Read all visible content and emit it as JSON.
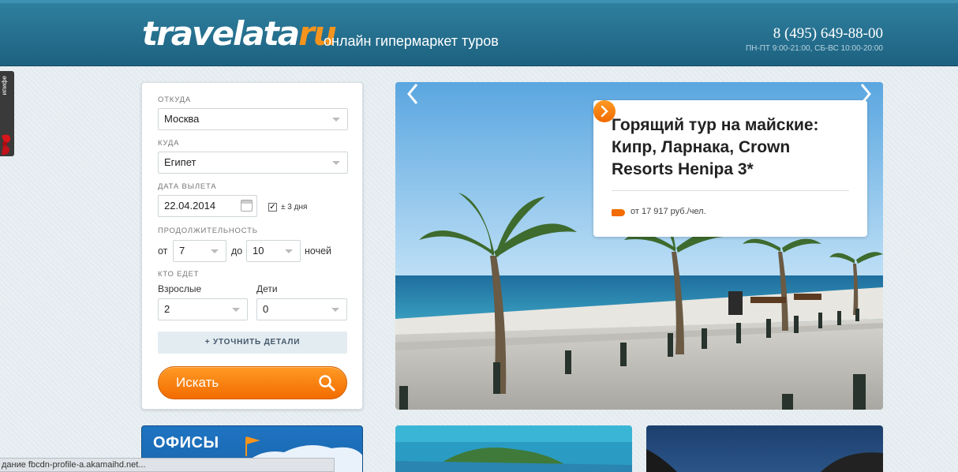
{
  "header": {
    "logo_main": "travelata",
    "logo_ru": "ru",
    "tagline": "онлайн гипермаркет туров",
    "phone": "8 (495) 649-88-00",
    "hours": "ПН-ПТ 9:00-21:00, СБ-ВС 10:00-20:00"
  },
  "side_tab": {
    "label": "ипифе"
  },
  "search": {
    "from_label": "ОТКУДА",
    "from_value": "Москва",
    "to_label": "КУДА",
    "to_value": "Египет",
    "date_label": "ДАТА ВЫЛЕТА",
    "date_value": "22.04.2014",
    "flex_label": "± 3 дня",
    "flex_checked": true,
    "duration_label": "ПРОДОЛЖИТЕЛЬНОСТЬ",
    "from_word": "от",
    "nights_from": "7",
    "to_word": "до",
    "nights_to": "10",
    "nights_word": "ночей",
    "who_label": "КТО ЕДЕТ",
    "adults_label": "Взрослые",
    "adults_value": "2",
    "children_label": "Дети",
    "children_value": "0",
    "details_button": "+ УТОЧНИТЬ ДЕТАЛИ",
    "search_button": "Искать"
  },
  "slider": {
    "title": "Горящий тур на майские: Кипр, Ларнака, Crown Resorts Henipa 3*",
    "price": "от 17 917 руб./чел."
  },
  "tiles": {
    "offices": "ОФИСЫ"
  },
  "status_bar": "дание fbcdn-profile-a.akamaihd.net...",
  "colors": {
    "header": "#1d6180",
    "accent_orange": "#f26c00",
    "offices_blue": "#1f74c2"
  }
}
